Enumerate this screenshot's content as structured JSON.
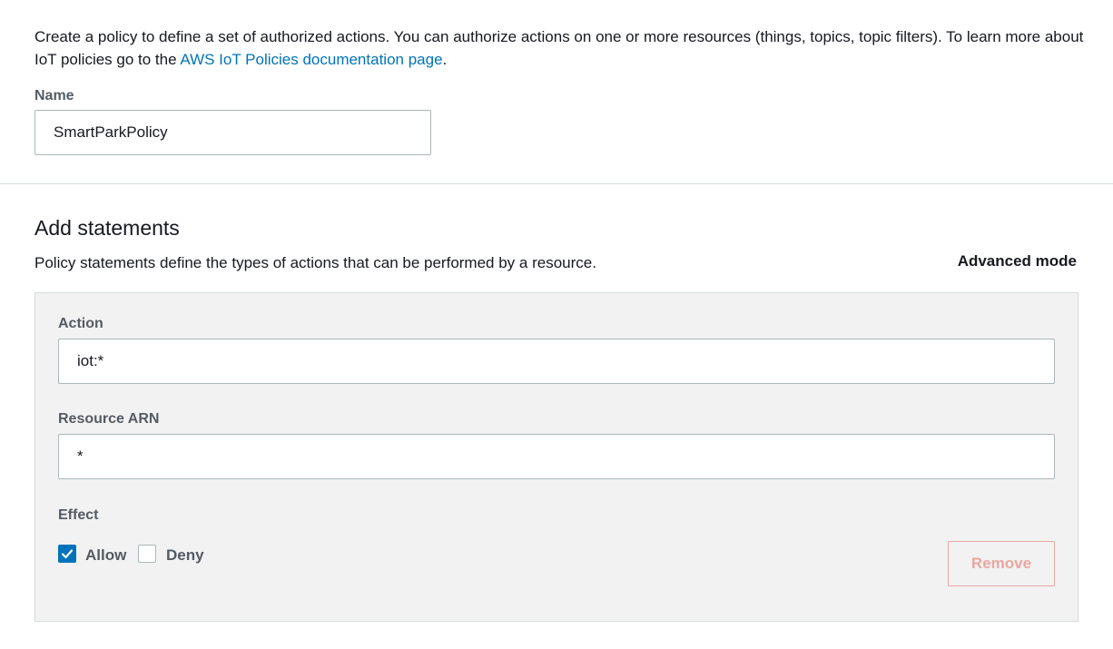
{
  "intro": {
    "text_before_link": "Create a policy to define a set of authorized actions. You can authorize actions on one or more resources (things, topics, topic filters). To learn more about IoT policies go to the ",
    "link_text": "AWS IoT Policies documentation page",
    "text_after_link": "."
  },
  "name_field": {
    "label": "Name",
    "value": "SmartParkPolicy"
  },
  "statements": {
    "title": "Add statements",
    "description": "Policy statements define the types of actions that can be performed by a resource.",
    "advanced_mode_label": "Advanced mode",
    "action": {
      "label": "Action",
      "value": "iot:*"
    },
    "resource_arn": {
      "label": "Resource ARN",
      "value": "*"
    },
    "effect": {
      "label": "Effect",
      "allow_label": "Allow",
      "allow_checked": true,
      "deny_label": "Deny",
      "deny_checked": false
    },
    "remove_label": "Remove"
  },
  "colors": {
    "link": "#0073bb",
    "checkbox_checked": "#0073bb",
    "remove_disabled": "#eaa7a0",
    "panel_background": "#f2f2f2"
  }
}
